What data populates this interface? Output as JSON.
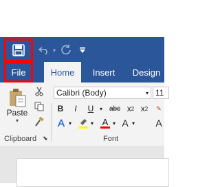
{
  "quick_access": {
    "save_icon": "save-icon",
    "undo_icon": "undo-icon",
    "redo_icon": "redo-icon",
    "customize_icon": "customize-quick-access-icon"
  },
  "tabs": [
    {
      "label": "File"
    },
    {
      "label": "Home"
    },
    {
      "label": "Insert"
    },
    {
      "label": "Design"
    }
  ],
  "clipboard": {
    "paste_label": "Paste",
    "group_label": "Clipboard"
  },
  "font": {
    "font_name": "Calibri (Body)",
    "font_size": "11",
    "group_label": "Font",
    "bold": "B",
    "italic": "I",
    "underline": "U",
    "strike": "abc",
    "subscript": "x",
    "superscript": "x",
    "text_effects": "A",
    "font_color": "A",
    "font_color_more": "A"
  },
  "colors": {
    "brand": "#2b579a",
    "highlight": "#ffff00",
    "font_color": "#ff0000",
    "callout": "#ff0000"
  }
}
